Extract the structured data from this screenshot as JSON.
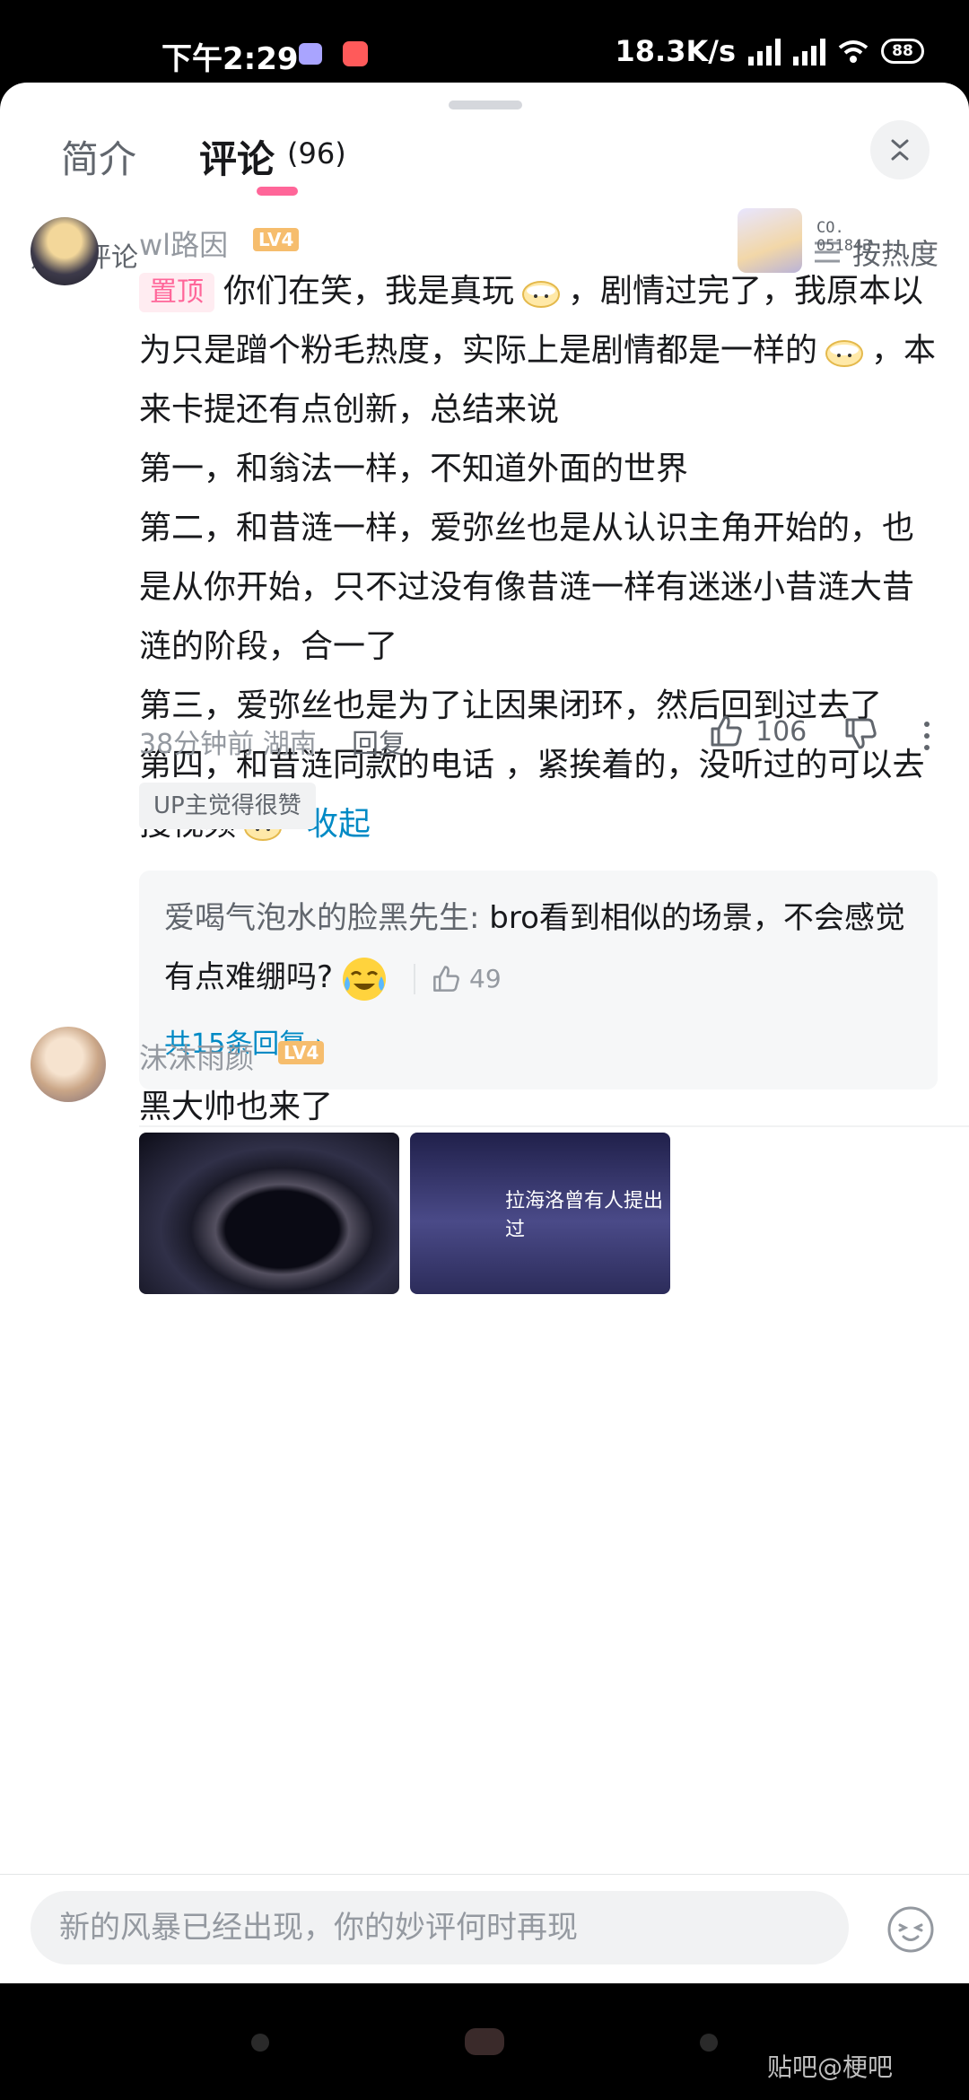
{
  "status_bar": {
    "time": "下午2:29",
    "network_speed": "18.3K/s",
    "battery": "88"
  },
  "tabs": [
    {
      "label": "简介",
      "active": false
    },
    {
      "label": "评论",
      "count": "(96)",
      "active": true
    }
  ],
  "section": {
    "title": "热门评论",
    "sort_label": "按热度"
  },
  "comments": [
    {
      "username": "wl路因",
      "level": "LV4",
      "card_number": "CO.\n051843",
      "pin_label": "置顶",
      "lines": [
        "你们在笑，我是真玩",
        "，剧情过完了，我原本以为只是蹭个粉毛热度，实际上是剧情都是一样的",
        "，本来卡提还有点创新，总结来说",
        "第一，和翁法一样，不知道外面的世界",
        "第二，和昔涟一样，爱弥丝也是从认识主角开始的，也是从你开始，只不过没有像昔涟一样有迷迷小昔涟大昔涟的阶段，合一了",
        "第三，爱弥丝也是为了让因果闭环，然后回到过去了",
        "第四，和昔涟同款的电话 ，紧挨着的，没听过的可以去搜视频"
      ],
      "collapse_label": "收起",
      "time": "38分钟前",
      "location": "湖南",
      "reply_label": "回复",
      "likes": "106",
      "up_tag": "UP主觉得很赞",
      "reply": {
        "name": "爱喝气泡水的脸黑先生:",
        "text": " bro看到相似的场景，不会感觉有点难绷吗?",
        "likes": "49",
        "more_label": "共15条回复"
      }
    },
    {
      "username": "沫沫雨颜",
      "level": "LV4",
      "text": "黑大帅也来了",
      "image2_caption": "拉海洛曾有人提出过"
    }
  ],
  "input": {
    "placeholder": "新的风暴已经出现，你的妙评何时再现"
  },
  "watermark": "贴吧@梗吧"
}
